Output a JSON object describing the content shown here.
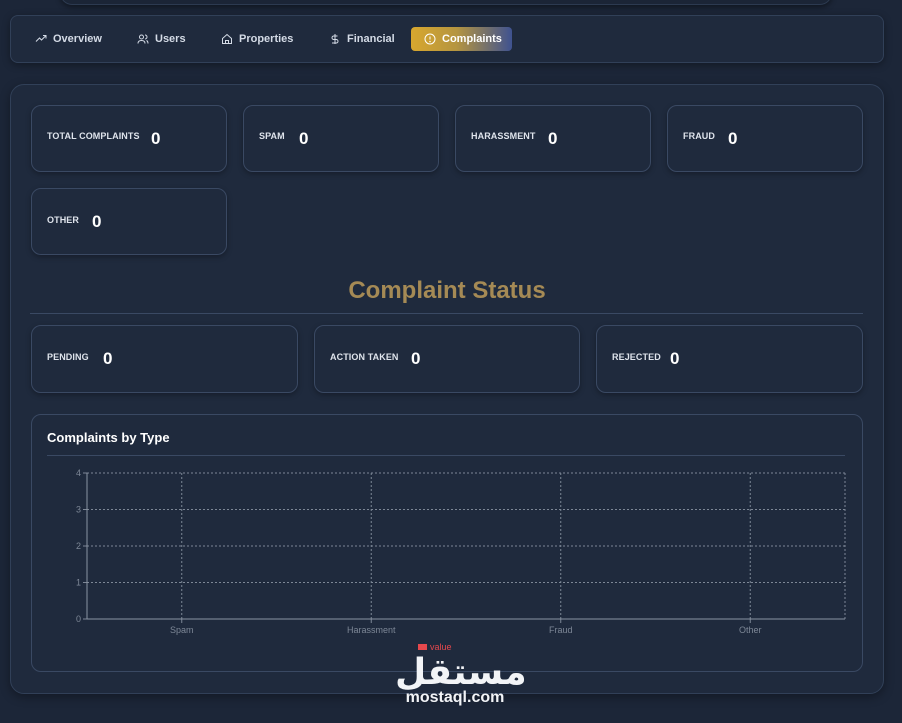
{
  "tabs": [
    {
      "label": "Overview",
      "icon": "trend-up-icon",
      "active": false
    },
    {
      "label": "Users",
      "icon": "users-icon",
      "active": false
    },
    {
      "label": "Properties",
      "icon": "home-icon",
      "active": false
    },
    {
      "label": "Financial",
      "icon": "dollar-icon",
      "active": false
    },
    {
      "label": "Complaints",
      "icon": "alert-circle-icon",
      "active": true
    }
  ],
  "stats": {
    "total": {
      "label": "TOTAL COMPLAINTS",
      "value": "0"
    },
    "spam": {
      "label": "SPAM",
      "value": "0"
    },
    "harassment": {
      "label": "HARASSMENT",
      "value": "0"
    },
    "fraud": {
      "label": "FRAUD",
      "value": "0"
    },
    "other": {
      "label": "OTHER",
      "value": "0"
    }
  },
  "status": {
    "title": "Complaint Status",
    "pending": {
      "label": "PENDING",
      "value": "0"
    },
    "action_taken": {
      "label": "ACTION TAKEN",
      "value": "0"
    },
    "rejected": {
      "label": "REJECTED",
      "value": "0"
    }
  },
  "chart": {
    "title": "Complaints by Type"
  },
  "chart_data": {
    "type": "bar",
    "title": "Complaints by Type",
    "categories": [
      "Spam",
      "Harassment",
      "Fraud",
      "Other"
    ],
    "series": [
      {
        "name": "value",
        "values": [
          0,
          0,
          0,
          0
        ],
        "color": "#e5484d"
      }
    ],
    "ylim": [
      0,
      4
    ],
    "yticks": [
      "0",
      "1",
      "2",
      "3",
      "4"
    ],
    "grid": true,
    "legend": "bottom-center"
  },
  "colors": {
    "accent_gold": "#d8a72e",
    "accent_blue": "#3f5290",
    "title_gold": "#a58a55"
  },
  "watermark": {
    "arabic": "مستقل",
    "latin": "mostaql.com"
  }
}
